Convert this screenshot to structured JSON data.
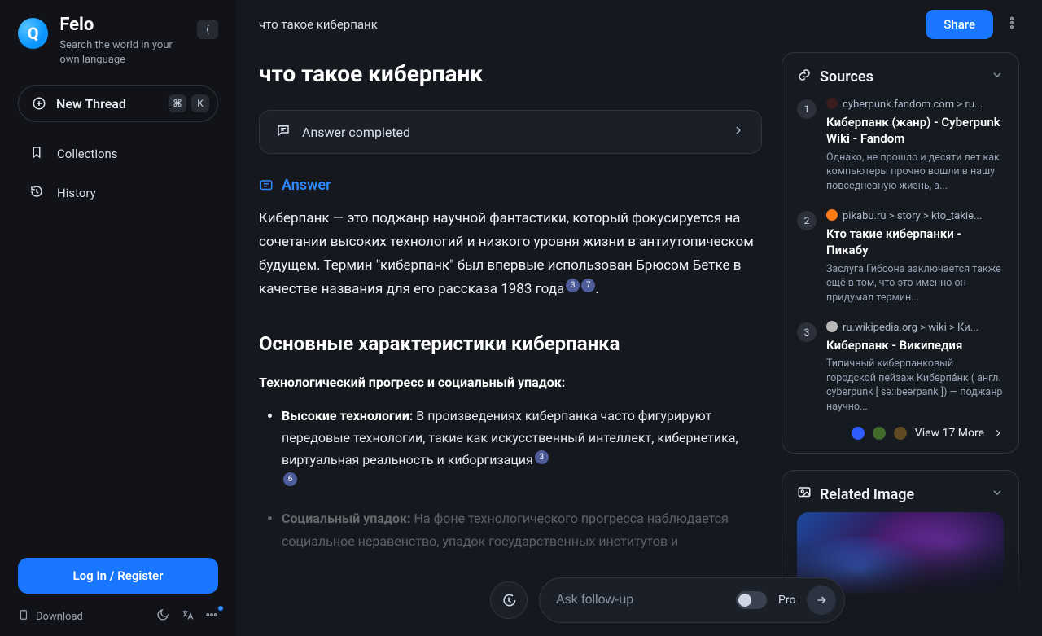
{
  "brand": {
    "name": "Felo",
    "tagline": "Search the world in your own language",
    "logo_glyph": "Q"
  },
  "sidebar": {
    "collapse_glyph": "⟨",
    "new_thread": {
      "label": "New Thread",
      "kbd1": "⌘",
      "kbd2": "K"
    },
    "items": [
      {
        "key": "collections",
        "label": "Collections"
      },
      {
        "key": "history",
        "label": "History"
      }
    ],
    "login_label": "Log In / Register",
    "download_label": "Download"
  },
  "topbar": {
    "title": "что такое киберпанк",
    "share_label": "Share"
  },
  "article": {
    "h1": "что такое киберпанк",
    "status": "Answer completed",
    "answer_label": "Answer",
    "answer_paragraph": "Киберпанк — это поджанр научной фантастики, который фокусируется на сочетании высоких технологий и низкого уровня жизни в антиутопическом будущем. Термин \"киберпанк\" был впервые использован Брюсом Бетке в качестве названия для его рассказа 1983 года",
    "answer_sups": [
      "3",
      "7"
    ],
    "answer_tail": ".",
    "h2": "Основные характеристики киберпанка",
    "h3": "Технологический прогресс и социальный упадок:",
    "bullets": [
      {
        "lead": "Высокие технологии:",
        "text": " В произведениях киберпанка часто фигурируют передовые технологии, такие как искусственный интеллект, кибернетика, виртуальная реальность и киборгизация",
        "sups": [
          "3",
          "6"
        ]
      },
      {
        "lead": "Социальный упадок:",
        "text": " На фоне технологического прогресса наблюдается социальное неравенство, упадок государственных институтов и",
        "sups": []
      }
    ]
  },
  "sources": {
    "heading": "Sources",
    "items": [
      {
        "num": "1",
        "domain": "cyberpunk.fandom.com > ru...",
        "title": "Киберпанк (жанр) - Cyberpunk Wiki - Fandom",
        "snippet": "Однако, не прошло и десяти лет как компьютеры прочно вошли в нашу повседневную жизнь, а..."
      },
      {
        "num": "2",
        "domain": "pikabu.ru > story > kto_takie...",
        "title": "Кто такие киберпанки - Пикабу",
        "snippet": "Заслуга Гибсона заключается также ещё в том, что это именно он придумал термин..."
      },
      {
        "num": "3",
        "domain": "ru.wikipedia.org > wiki > Ки...",
        "title": "Киберпанк - Википедия",
        "snippet": "Типичный киберпанковый городской пейзаж Киберпа́нк ( англ.  cyberpunk [ sə:ibeərpank ]) — поджанр научно..."
      }
    ],
    "view_more": "View 17 More"
  },
  "related_image": {
    "heading": "Related Image"
  },
  "followup": {
    "placeholder": "Ask follow-up",
    "pro_label": "Pro"
  }
}
